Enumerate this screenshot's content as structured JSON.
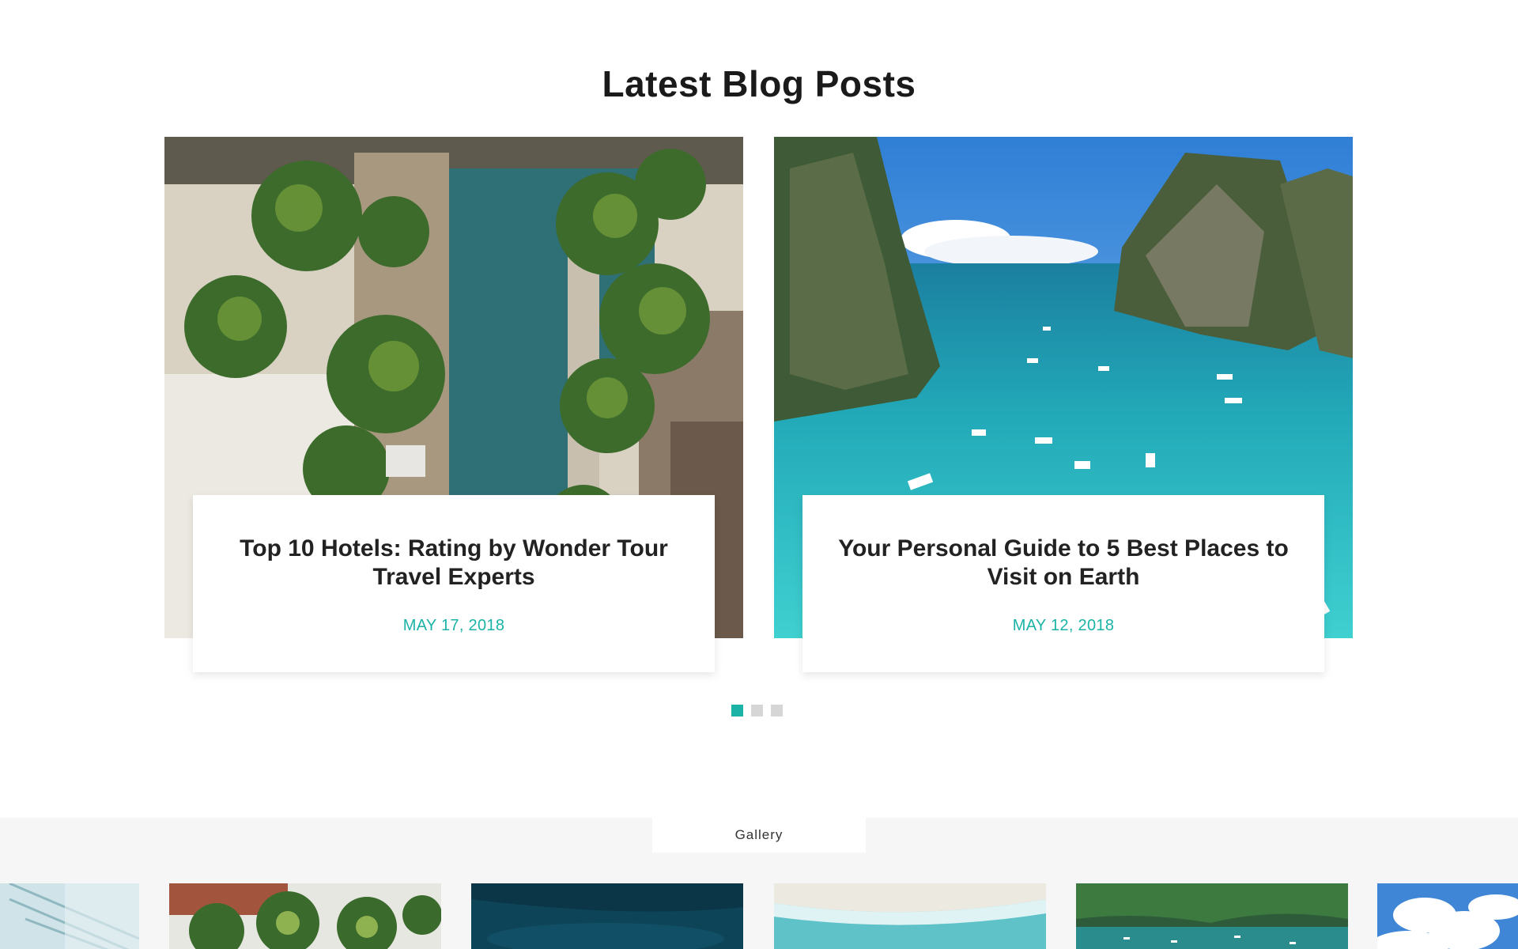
{
  "blog": {
    "title": "Latest Blog Posts",
    "posts": [
      {
        "title": "Top 10 Hotels: Rating by Wonder Tour Travel Experts",
        "date": "MAY 17, 2018"
      },
      {
        "title": "Your Personal Guide to 5 Best Places to Visit on Earth",
        "date": "MAY 12, 2018"
      }
    ],
    "pagination": {
      "count": 3,
      "active": 1
    }
  },
  "gallery": {
    "tab_label": "Gallery"
  },
  "colors": {
    "accent": "#1bb3a6",
    "title": "#1a1a1a",
    "dot_inactive": "#d6d6d6",
    "gallery_bg": "#f6f6f6"
  }
}
